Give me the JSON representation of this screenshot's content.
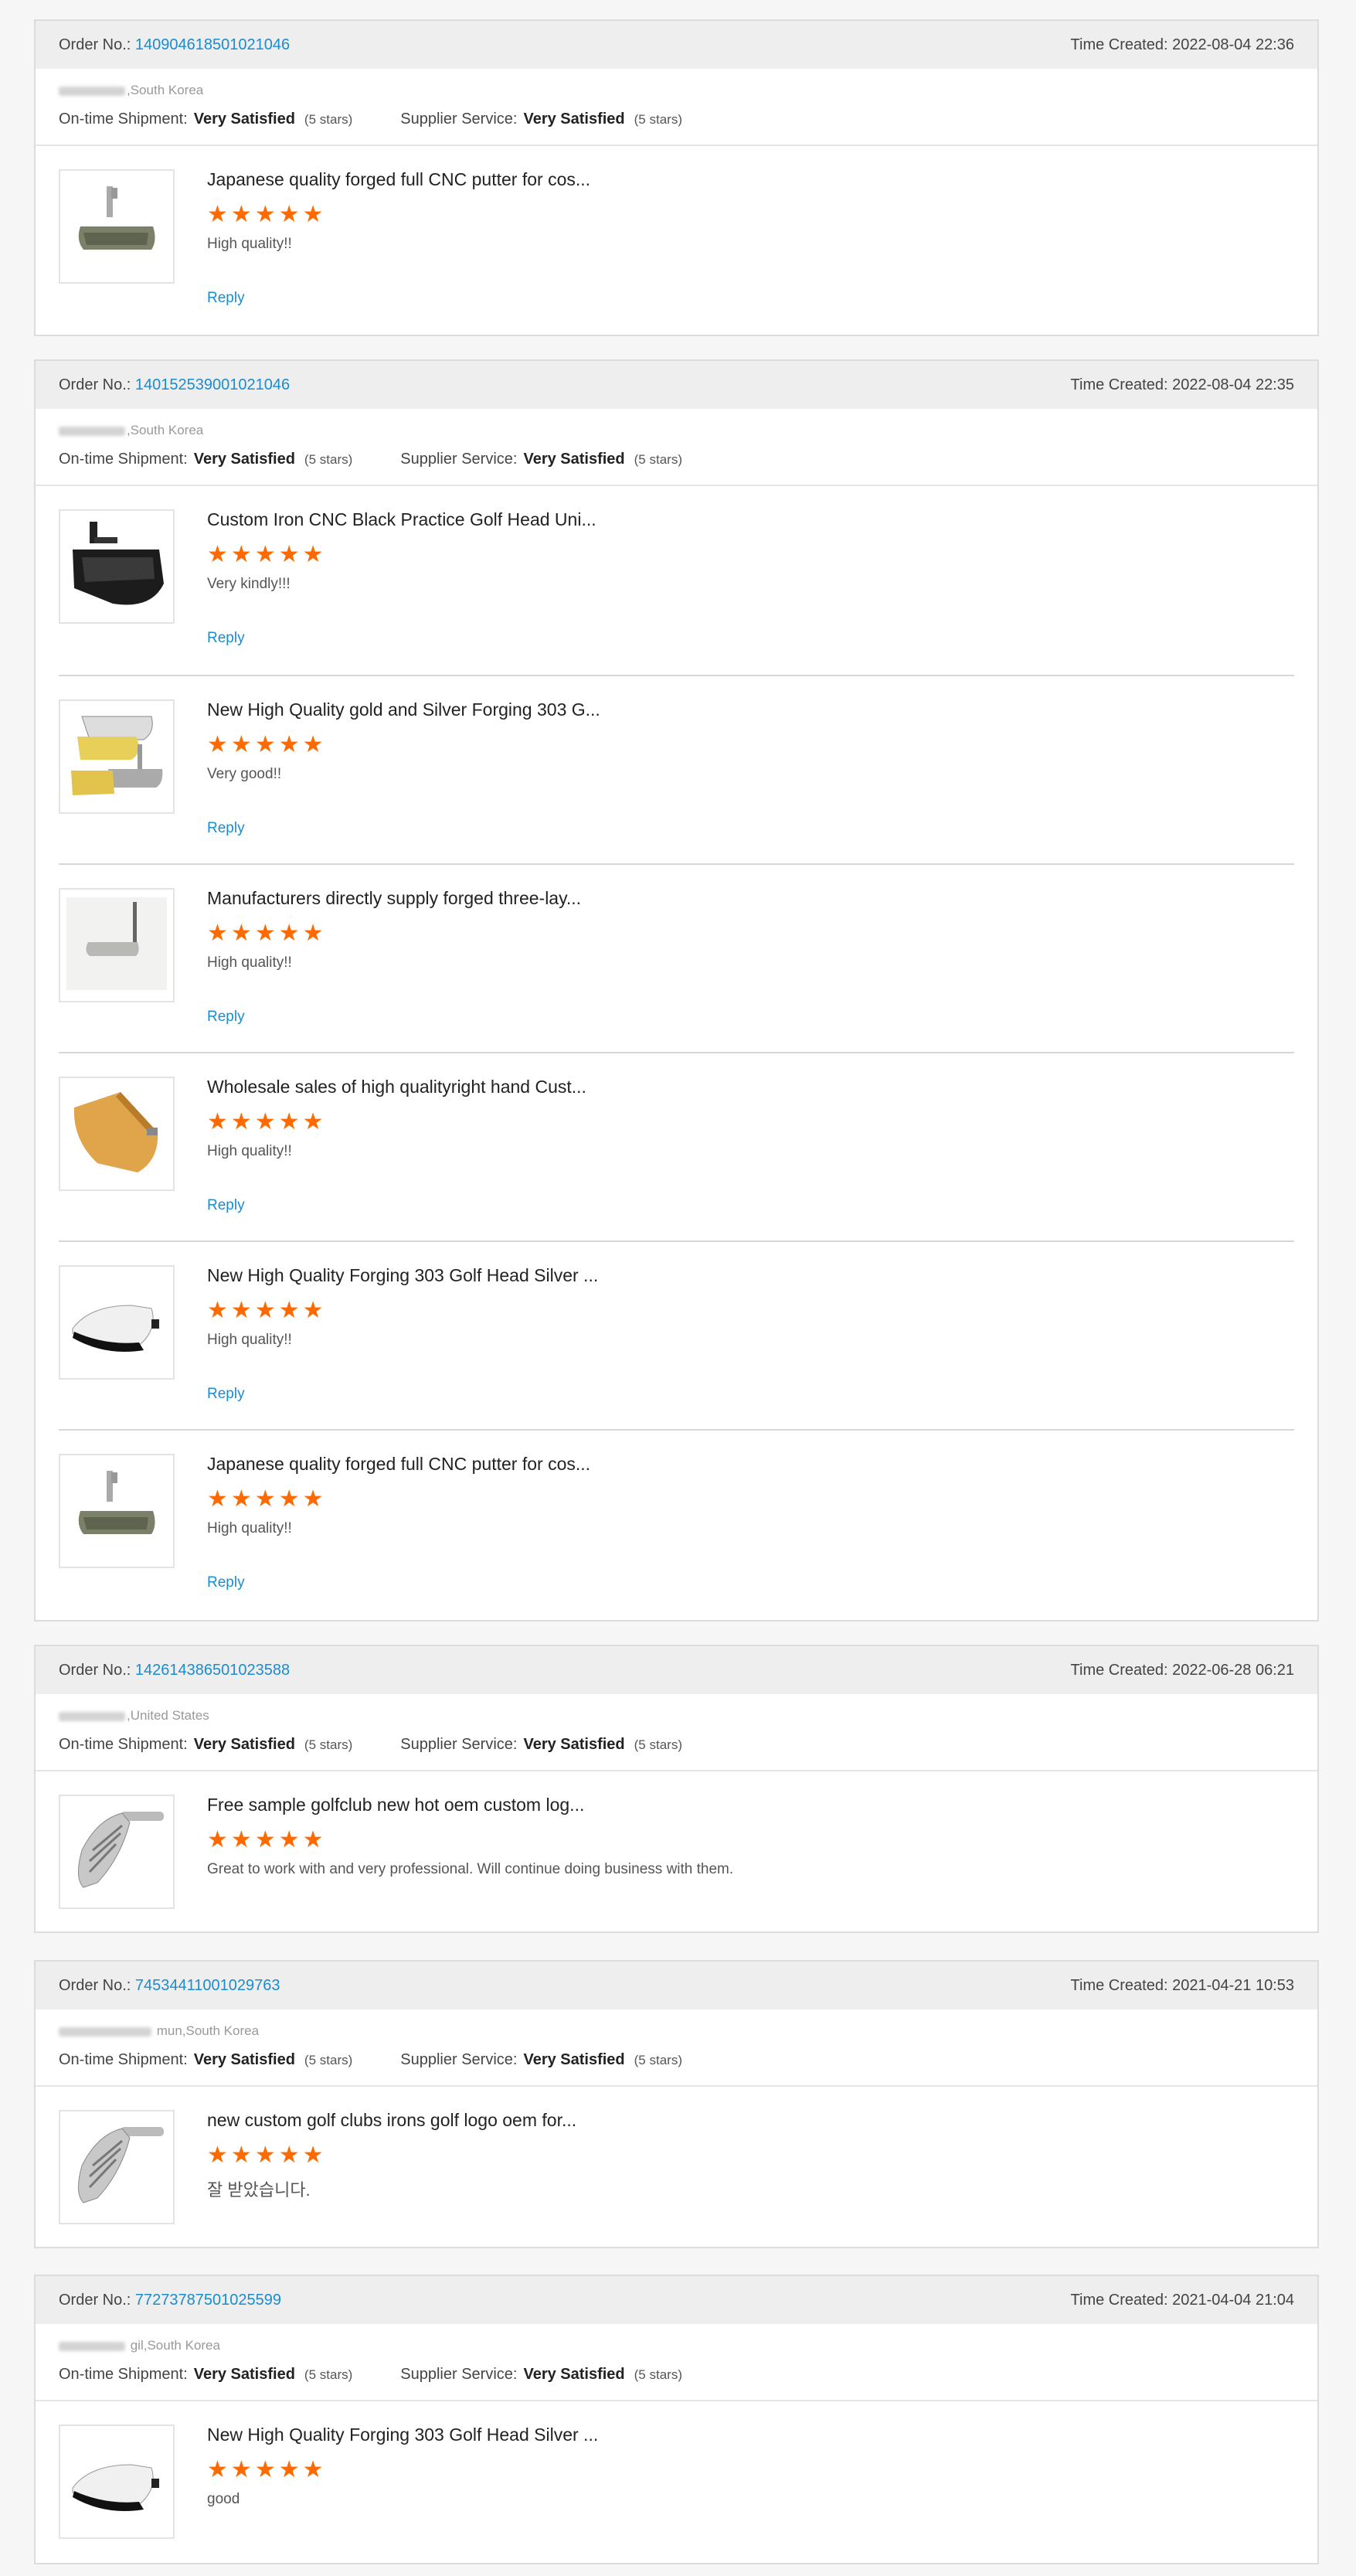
{
  "labels": {
    "order_no": "Order No.:",
    "time_created": "Time Created:",
    "on_time_shipment": "On-time Shipment:",
    "supplier_service": "Supplier Service:",
    "reply": "Reply"
  },
  "colors": {
    "star": "#ff6a00",
    "link": "#1a8cd0",
    "header_bg": "#eeeeee"
  },
  "orders": [
    {
      "order_no": "140904618501021046",
      "time_created": "2022-08-04 22:36",
      "buyer_location": ",South Korea",
      "on_time_value": "Very Satisfied",
      "on_time_stars": "(5 stars)",
      "supplier_value": "Very Satisfied",
      "supplier_stars": "(5 stars)",
      "items": [
        {
          "title": "Japanese quality forged full CNC putter for cos...",
          "rating": 5,
          "comment": "High quality!!",
          "reply": "Reply",
          "image": "putter-cnc-image"
        }
      ]
    },
    {
      "order_no": "140152539001021046",
      "time_created": "2022-08-04 22:35",
      "buyer_location": ",South Korea",
      "on_time_value": "Very Satisfied",
      "on_time_stars": "(5 stars)",
      "supplier_value": "Very Satisfied",
      "supplier_stars": "(5 stars)",
      "items": [
        {
          "title": "Custom Iron CNC Black Practice Golf Head Uni...",
          "rating": 5,
          "comment": "Very kindly!!!",
          "reply": "Reply",
          "image": "black-putter-head-image"
        },
        {
          "title": "New High Quality gold and Silver Forging 303 G...",
          "rating": 5,
          "comment": "Very good!!",
          "reply": "Reply",
          "image": "gold-silver-putters-image"
        },
        {
          "title": "Manufacturers directly supply forged three-lay...",
          "rating": 5,
          "comment": "High quality!!",
          "reply": "Reply",
          "image": "blade-putter-image"
        },
        {
          "title": "Wholesale sales of high qualityright hand Cust...",
          "rating": 5,
          "comment": "High quality!!",
          "reply": "Reply",
          "image": "gold-putter-head-image"
        },
        {
          "title": "New High Quality Forging 303 Golf Head Silver ...",
          "rating": 5,
          "comment": "High quality!!",
          "reply": "Reply",
          "image": "silver-putter-head-image"
        },
        {
          "title": "Japanese quality forged full CNC putter for cos...",
          "rating": 5,
          "comment": "High quality!!",
          "reply": "Reply",
          "image": "putter-cnc-image"
        }
      ]
    },
    {
      "order_no": "142614386501023588",
      "time_created": "2022-06-28 06:21",
      "buyer_location": ",United States",
      "on_time_value": "Very Satisfied",
      "on_time_stars": "(5 stars)",
      "supplier_value": "Very Satisfied",
      "supplier_stars": "(5 stars)",
      "items": [
        {
          "title": "Free sample golfclub new hot oem custom log...",
          "rating": 5,
          "comment": "Great to work with and very professional.  Will continue doing business with them.",
          "reply": "",
          "image": "iron-club-head-image"
        }
      ]
    },
    {
      "order_no": "74534411001029763",
      "time_created": "2021-04-21 10:53",
      "buyer_location": " mun,South Korea",
      "on_time_value": "Very Satisfied",
      "on_time_stars": "(5 stars)",
      "supplier_value": "Very Satisfied",
      "supplier_stars": "(5 stars)",
      "items": [
        {
          "title": "new custom golf clubs irons golf logo oem for...",
          "rating": 5,
          "comment": "잘 받았습니다.",
          "reply": "",
          "image": "iron-club-head-image"
        }
      ]
    },
    {
      "order_no": "77273787501025599",
      "time_created": "2021-04-04 21:04",
      "buyer_location": " gil,South Korea",
      "on_time_value": "Very Satisfied",
      "on_time_stars": "(5 stars)",
      "supplier_value": "Very Satisfied",
      "supplier_stars": "(5 stars)",
      "items": [
        {
          "title": "New High Quality Forging 303 Golf Head Silver ...",
          "rating": 5,
          "comment": "good",
          "reply": "",
          "image": "silver-putter-head-image"
        }
      ]
    }
  ]
}
